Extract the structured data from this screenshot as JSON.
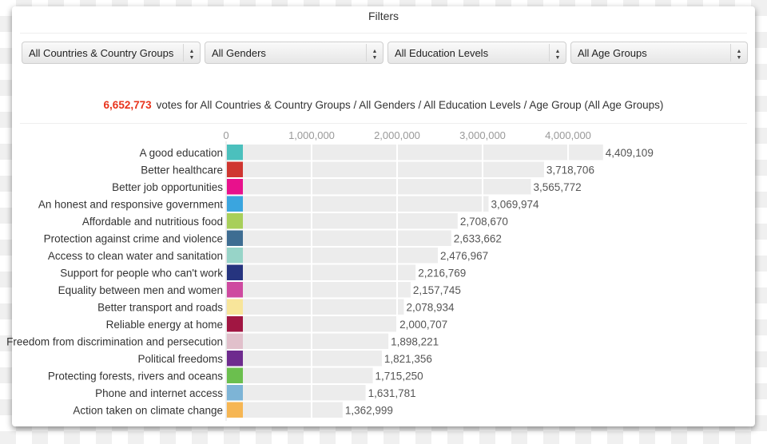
{
  "panel": {
    "title": "Filters"
  },
  "filters": [
    {
      "name": "country",
      "selected": "All Countries & Country Groups"
    },
    {
      "name": "gender",
      "selected": "All Genders"
    },
    {
      "name": "education",
      "selected": "All Education Levels"
    },
    {
      "name": "age",
      "selected": "All Age Groups"
    }
  ],
  "summary": {
    "total_votes": "6,652,773",
    "text": "votes for All Countries & Country Groups / All Genders / All Education Levels / Age Group (All Age Groups)",
    "total_color": "#e8331c"
  },
  "chart_data": {
    "type": "bar",
    "orientation": "horizontal",
    "title": "",
    "xlabel": "",
    "ylabel": "",
    "xlim": [
      0,
      4500000
    ],
    "xticks": [
      0,
      1000000,
      2000000,
      3000000,
      4000000
    ],
    "xtick_labels": [
      "0",
      "1,000,000",
      "2,000,000",
      "3,000,000",
      "4,000,000"
    ],
    "grid": true,
    "categories": [
      "A good education",
      "Better healthcare",
      "Better job opportunities",
      "An honest and responsive government",
      "Affordable and nutritious food",
      "Protection against crime and violence",
      "Access to clean water and sanitation",
      "Support for people who can't work",
      "Equality between men and women",
      "Better transport and roads",
      "Reliable energy at home",
      "Freedom from discrimination and persecution",
      "Political freedoms",
      "Protecting forests, rivers and oceans",
      "Phone and internet access",
      "Action taken on climate change"
    ],
    "values": [
      4409109,
      3718706,
      3565772,
      3069974,
      2708670,
      2633662,
      2476967,
      2216769,
      2157745,
      2078934,
      2000707,
      1898221,
      1821356,
      1715250,
      1631781,
      1362999
    ],
    "value_labels": [
      "4,409,109",
      "3,718,706",
      "3,565,772",
      "3,069,974",
      "2,708,670",
      "2,633,662",
      "2,476,967",
      "2,216,769",
      "2,157,745",
      "2,078,934",
      "2,000,707",
      "1,898,221",
      "1,821,356",
      "1,715,250",
      "1,631,781",
      "1,362,999"
    ],
    "category_colors": [
      "#4bc0bd",
      "#cf3630",
      "#e8118c",
      "#3aa5df",
      "#a8cf5a",
      "#3e6d92",
      "#97d4c8",
      "#26347f",
      "#ce4aa0",
      "#f8e59a",
      "#a11642",
      "#e1c0cb",
      "#6e2b8e",
      "#6bbf4e",
      "#7db4d6",
      "#f6b653"
    ],
    "bar_color": "#ececec"
  }
}
